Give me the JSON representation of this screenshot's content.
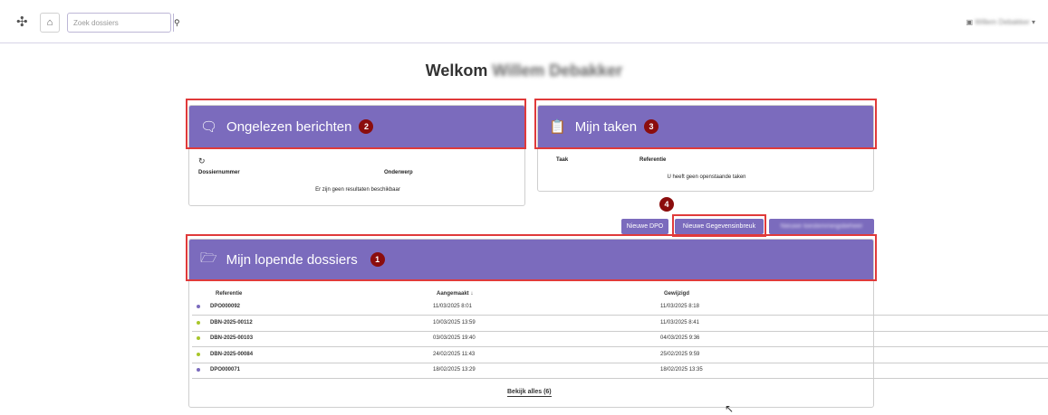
{
  "topbar": {
    "search_placeholder": "Zoek dossiers",
    "user_name": "Willem Debakker",
    "user_caret": "▾"
  },
  "welcome": {
    "prefix": "Welkom",
    "name": "Willem Debakker"
  },
  "messages_card": {
    "title": "Ongelezen berichten",
    "badge": "2",
    "col_dossier": "Dossiernummer",
    "col_subject": "Onderwerp",
    "empty_text": "Er zijn geen resultaten beschikbaar"
  },
  "tasks_card": {
    "title": "Mijn taken",
    "badge": "3",
    "col_task": "Taak",
    "col_reference": "Referentie",
    "empty_text": "U heeft geen openstaande taken"
  },
  "action_badge": "4",
  "buttons": {
    "new_dpo": "Nieuwe DPO",
    "new_breach": "Nieuwe Gegevensinbreuk",
    "third": "Nieuwe toestemmingsbeheer"
  },
  "dossiers_card": {
    "title": "Mijn lopende dossiers",
    "badge": "1",
    "col_reference": "Referentie",
    "col_created": "Aangemaakt ↓",
    "col_modified": "Gewijzigd",
    "rows": [
      {
        "reference": "DPO000092",
        "created": "11/03/2025 8:01",
        "modified": "11/03/2025 8:18",
        "dot_color": "#7b6bbd"
      },
      {
        "reference": "DBN-2025-00112",
        "created": "10/03/2025 13:59",
        "modified": "11/03/2025 8:41",
        "dot_color": "#a8c62a"
      },
      {
        "reference": "DBN-2025-00103",
        "created": "03/03/2025 19:40",
        "modified": "04/03/2025 9:36",
        "dot_color": "#a8c62a"
      },
      {
        "reference": "DBN-2025-00084",
        "created": "24/02/2025 11:43",
        "modified": "25/02/2025 9:59",
        "dot_color": "#a8c62a"
      },
      {
        "reference": "DPO000071",
        "created": "18/02/2025 13:29",
        "modified": "18/02/2025 13:35",
        "dot_color": "#7b6bbd"
      }
    ],
    "view_all": "Bekijk alles (6)"
  },
  "colors": {
    "accent": "#7b6bbd",
    "badge": "#8b0d0d",
    "highlight": "#e03a3a"
  }
}
